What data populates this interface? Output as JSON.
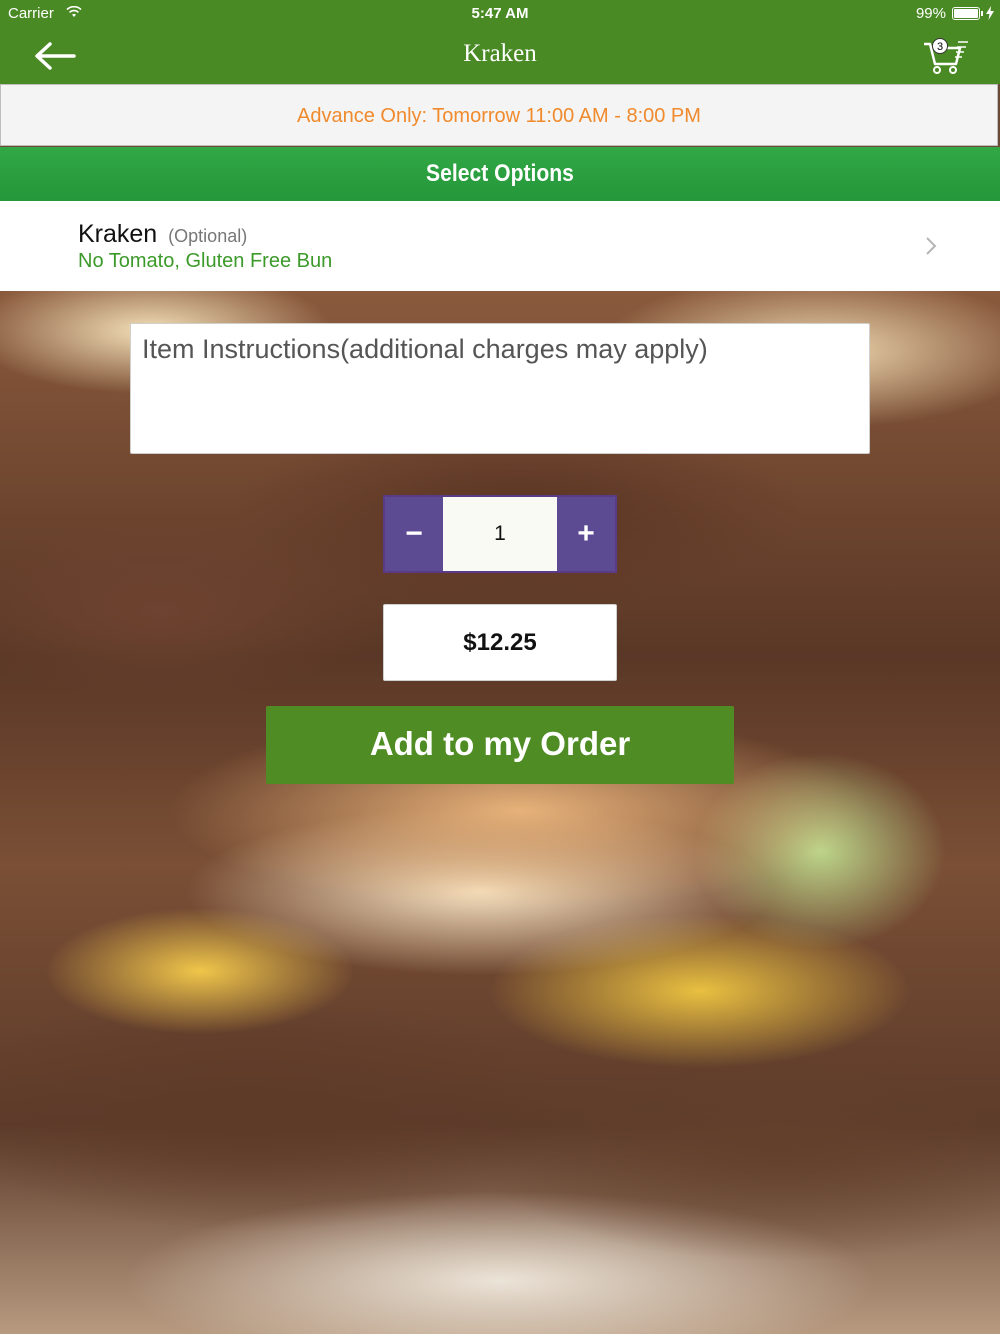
{
  "status_bar": {
    "carrier": "Carrier",
    "time": "5:47 AM",
    "battery": "99%"
  },
  "nav": {
    "title": "Kraken",
    "back_icon": "arrow-left-icon",
    "cart_icon": "shopping-cart-icon",
    "cart_count": "3"
  },
  "banner": {
    "text": "Advance Only: Tomorrow 11:00 AM - 8:00 PM"
  },
  "section": {
    "title": "Select Options"
  },
  "option": {
    "name": "Kraken",
    "optional_label": "(Optional)",
    "selected_values": "No Tomato, Gluten Free Bun",
    "chevron_icon": "chevron-right-icon"
  },
  "instructions": {
    "placeholder": "Item Instructions(additional charges may apply)"
  },
  "quantity": {
    "minus_label": "−",
    "value": "1",
    "plus_label": "+"
  },
  "price": {
    "value": "$12.25"
  },
  "add_button": {
    "label": "Add to my Order"
  },
  "colors": {
    "nav_green": "#4a8a25",
    "banner_orange": "#f08a2c",
    "header_green": "#2aa03e",
    "stepper_purple": "#5c4a93",
    "add_green": "#4f8c23"
  }
}
